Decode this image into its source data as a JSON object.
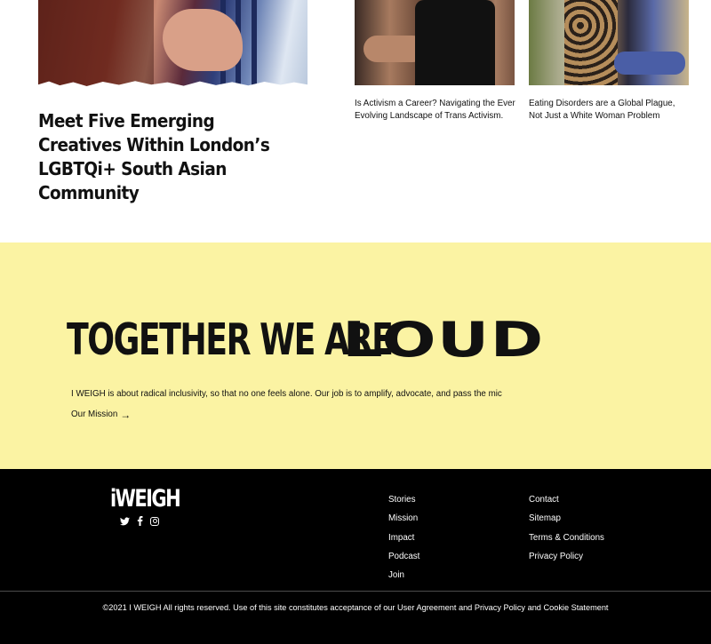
{
  "articles": {
    "feature": {
      "title": "Meet Five Emerging Creatives Within London’s LGBTQi+ South Asian Community"
    },
    "cards": [
      {
        "caption": "Is Activism a Career? Navigating the Ever Evolving Landscape of Trans Activism."
      },
      {
        "caption": "Eating Disorders are a Global Plague, Not Just a White Woman Problem"
      }
    ]
  },
  "banner": {
    "background_color": "#fbf3a3",
    "slogan_lead": "TOGETHER WE ARE",
    "slogan_emphasis": "LOUD",
    "description": "I WEIGH is about radical inclusivity, so that no one feels alone. Our job is to amplify, advocate, and pass the mic",
    "mission_link": "Our Mission",
    "mission_link_icon": "arrow-right-icon"
  },
  "footer": {
    "background_color": "#000000",
    "logo": "iWEIGH",
    "social_icons": [
      "twitter-icon",
      "facebook-icon",
      "instagram-icon"
    ],
    "links_col1": [
      "Stories",
      "Mission",
      "Impact",
      "Podcast",
      "Join"
    ],
    "links_col2": [
      "Contact",
      "Sitemap",
      "Terms & Conditions",
      "Privacy Policy"
    ],
    "copyright": "©2021 I WEIGH All rights reserved. Use of this site constitutes acceptance of our User Agreement and Privacy Policy and Cookie Statement"
  }
}
